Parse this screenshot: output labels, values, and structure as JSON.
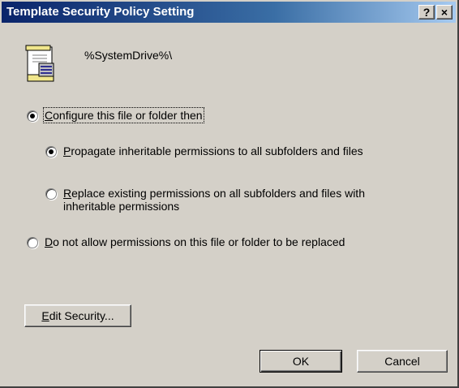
{
  "window": {
    "title": "Template Security Policy Setting",
    "help_button": "?",
    "close_button": "×"
  },
  "header": {
    "path": "%SystemDrive%\\",
    "icon": "policy-document-icon"
  },
  "options": {
    "configure": {
      "key": "C",
      "rest": "onfigure this file or folder then",
      "checked": true
    },
    "propagate": {
      "key": "P",
      "rest": "ropagate inheritable permissions to all subfolders and files",
      "checked": true
    },
    "replace": {
      "key": "R",
      "rest": "eplace existing permissions on all subfolders and files with",
      "line2": "inheritable permissions",
      "checked": false
    },
    "do_not_allow": {
      "key": "D",
      "rest": "o not allow permissions on this file or folder to be replaced",
      "checked": false
    }
  },
  "buttons": {
    "edit_security": {
      "key": "E",
      "rest": "dit Security..."
    },
    "ok": "OK",
    "cancel": "Cancel"
  },
  "colors": {
    "face": "#d4d0c8",
    "title_start": "#0a246a",
    "title_end": "#a6caf0"
  }
}
